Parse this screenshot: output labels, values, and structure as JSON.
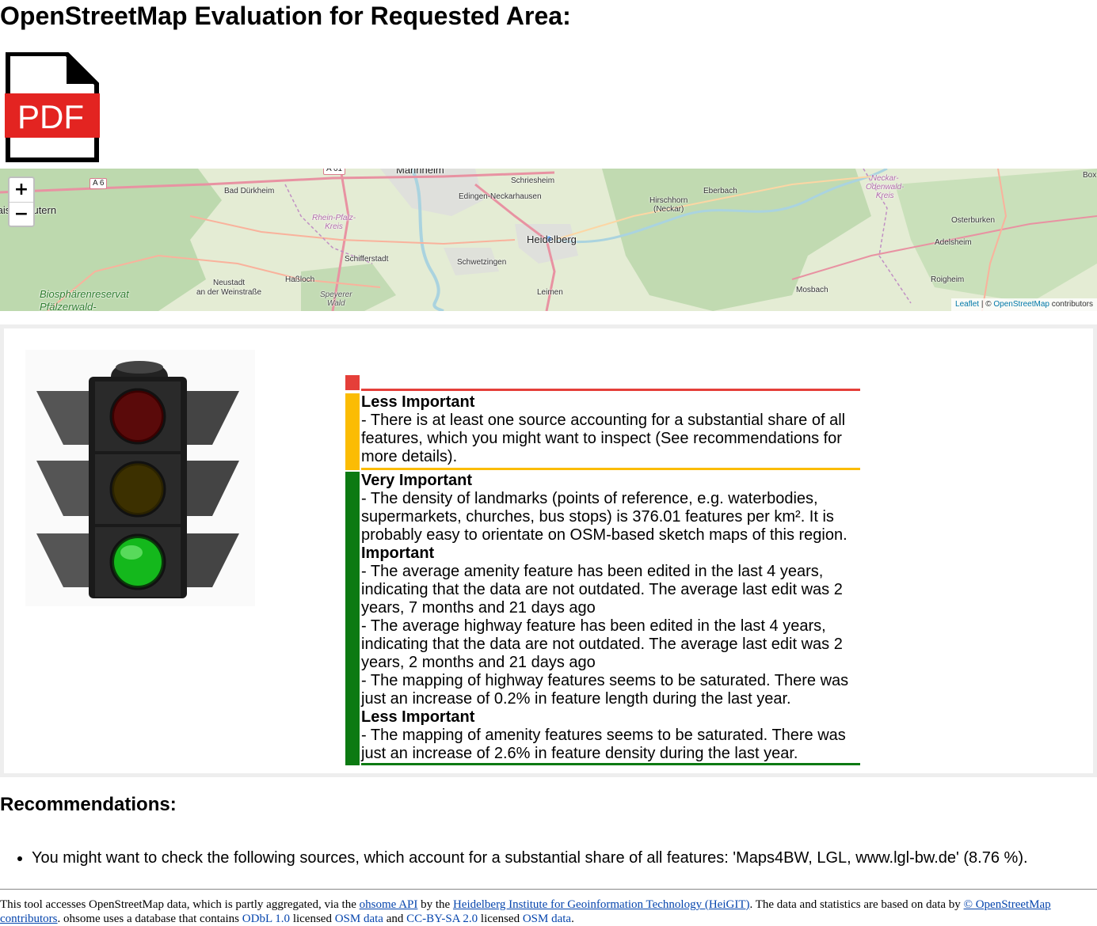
{
  "page": {
    "title": "OpenStreetMap Evaluation for Requested Area:"
  },
  "pdf": {
    "label": "PDF",
    "icon": "pdf-file-icon"
  },
  "map": {
    "zoom_in": "+",
    "zoom_out": "−",
    "attribution": {
      "leaflet": "Leaflet",
      "sep": " | © ",
      "osm": "OpenStreetMap",
      "suffix": " contributors"
    },
    "places": {
      "mannheim": "Mannheim",
      "schriesheim": "Schriesheim",
      "edingen": "Edingen-Neckarhausen",
      "heidelberg": "Heidelberg",
      "schwetzingen": "Schwetzingen",
      "leimen": "Leimen",
      "hirschhorn": "Hirschhorn\n(Neckar)",
      "eberbach": "Eberbach",
      "mosbach": "Mosbach",
      "osterburken": "Osterburken",
      "adelsheim": "Adelsheim",
      "roigheim": "Roigheim",
      "bad_durkheim": "Bad Dürkheim",
      "schifferstadt": "Schifferstadt",
      "hassloch": "Haßloch",
      "neustadt": "Neustadt\nan der Weinstraße",
      "kaiserslautern": "Kaiserslautern",
      "rhein_pfalz": "Rhein-Pfalz-\nKreis",
      "neckar_odenwald": "Neckar-\nOdenwald-\nKreis",
      "speyerer_wald": "Speyerer\nWald",
      "biosphere": "Biosphärenreservat\nPfälzerwald-",
      "box": "Box",
      "a6": "A 6",
      "a61": "A 61"
    }
  },
  "traffic_light": {
    "status": "green",
    "icon": "traffic-light-icon"
  },
  "indicators": {
    "red": {
      "color": "#e53f39"
    },
    "yellow": {
      "color": "#fbbc04",
      "groups": [
        {
          "level": "Less Important",
          "items": [
            "- There is at least one source accounting for a substantial share of all features, which you might want to inspect (See recommendations for more details)."
          ]
        }
      ]
    },
    "green": {
      "color": "#0c7a12",
      "groups": [
        {
          "level": "Very Important",
          "items": [
            "- The density of landmarks (points of reference, e.g. waterbodies, supermarkets, churches, bus stops) is 376.01 features per km². It is probably easy to orientate on OSM-based sketch maps of this region."
          ]
        },
        {
          "level": "Important",
          "items": [
            "- The average amenity feature has been edited in the last 4 years, indicating that the data are not outdated. The average last edit was 2 years, 7 months and 21 days ago",
            "- The average highway feature has been edited in the last 4 years, indicating that the data are not outdated. The average last edit was 2 years, 2 months and 21 days ago",
            "- The mapping of highway features seems to be saturated. There was just an increase of 0.2% in feature length during the last year."
          ]
        },
        {
          "level": "Less Important",
          "items": [
            "- The mapping of amenity features seems to be saturated. There was just an increase of 2.6% in feature density during the last year."
          ]
        }
      ]
    }
  },
  "recommendations": {
    "title": "Recommendations:",
    "items": [
      "You might want to check the following sources, which account for a substantial share of all features: 'Maps4BW, LGL, www.lgl-bw.de' (8.76 %)."
    ]
  },
  "footer": {
    "t1": "This tool accesses OpenStreetMap data, which is partly aggregated, via the ",
    "ohsome_api": "ohsome API",
    "t2": " by the ",
    "heigit": "Heidelberg Institute for Geoinformation Technology (HeiGIT)",
    "t3": ". The data and statistics are based on data by ",
    "osm_contributors": "© OpenStreetMap contributors",
    "t4": ". ohsome uses a database that contains ",
    "odbl": "ODbL 1.0",
    "t5": " licensed ",
    "osm_data_1": "OSM data",
    "t6": " and ",
    "ccbysa": "CC-BY-SA 2.0",
    "t7": " licensed ",
    "osm_data_2": "OSM data",
    "t8": "."
  }
}
